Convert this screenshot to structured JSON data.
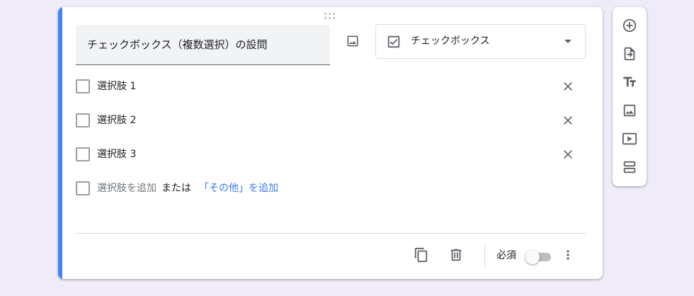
{
  "question": {
    "title": "チェックボックス（複数選択）の設問",
    "type_label": "チェックボックス",
    "options": [
      {
        "label": "選択肢 1"
      },
      {
        "label": "選択肢 2"
      },
      {
        "label": "選択肢 3"
      }
    ],
    "add_option_label": "選択肢を追加",
    "or_text": "または",
    "add_other_label": "「その他」を追加",
    "required_label": "必須",
    "required": false
  },
  "colors": {
    "accent": "#4285f4",
    "link": "#3b78e7",
    "background": "#efebf8"
  },
  "icons": {
    "title_image": "image-icon",
    "type_select": "checkbox-checked-icon",
    "caret": "caret-down-icon",
    "remove": "close-icon",
    "duplicate": "copy-icon",
    "delete": "trash-icon",
    "more": "more-vert-icon"
  },
  "side_toolbar": [
    "add-question-icon",
    "import-questions-icon",
    "add-title-icon",
    "add-image-icon",
    "add-video-icon",
    "add-section-icon"
  ]
}
